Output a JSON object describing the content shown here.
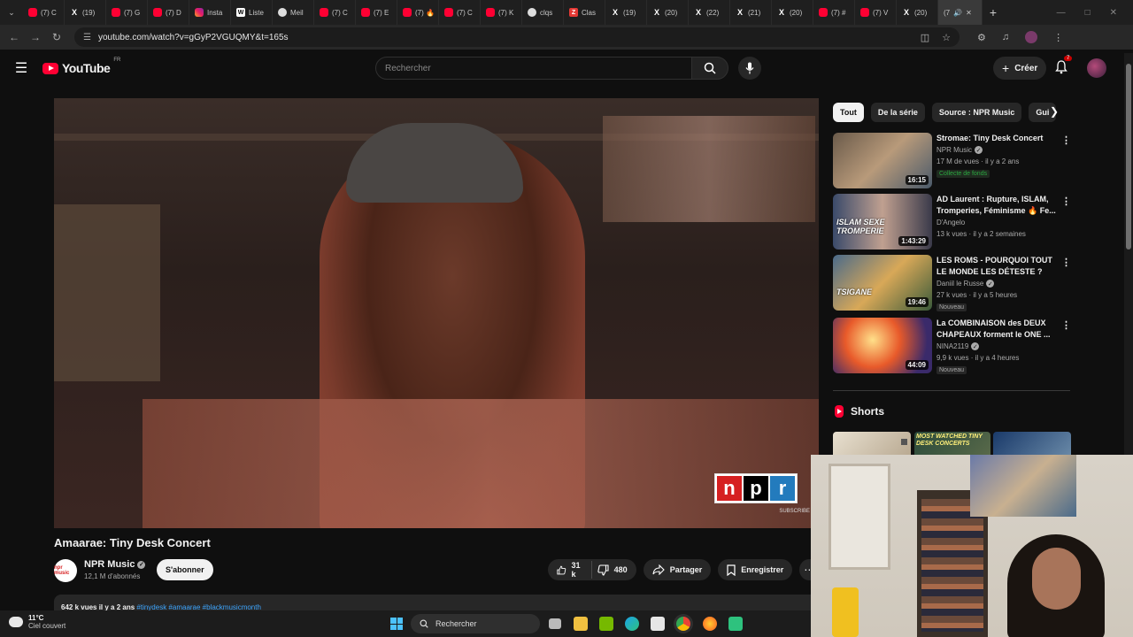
{
  "browser": {
    "tabs": [
      {
        "icon": "yt",
        "label": "(7) C"
      },
      {
        "icon": "x",
        "label": "(19)"
      },
      {
        "icon": "yt",
        "label": "(7) G"
      },
      {
        "icon": "yt",
        "label": "(7) D"
      },
      {
        "icon": "ig",
        "label": "Insta"
      },
      {
        "icon": "w",
        "label": "Liste"
      },
      {
        "icon": "gl",
        "label": "Meil"
      },
      {
        "icon": "yt",
        "label": "(7) C"
      },
      {
        "icon": "yt",
        "label": "(7) E"
      },
      {
        "icon": "yt",
        "label": "(7) 🔥"
      },
      {
        "icon": "yt",
        "label": "(7) C"
      },
      {
        "icon": "yt",
        "label": "(7) K"
      },
      {
        "icon": "gl",
        "label": "clqs"
      },
      {
        "icon": "z",
        "label": "Clas"
      },
      {
        "icon": "x",
        "label": "(19)"
      },
      {
        "icon": "x",
        "label": "(20)"
      },
      {
        "icon": "x",
        "label": "(22)"
      },
      {
        "icon": "x",
        "label": "(21)"
      },
      {
        "icon": "x",
        "label": "(20)"
      },
      {
        "icon": "yt",
        "label": "(7) #"
      },
      {
        "icon": "yt",
        "label": "(7) V"
      },
      {
        "icon": "x",
        "label": "(20)"
      }
    ],
    "active_tab_label": "(7",
    "url": "youtube.com/watch?v=gGyP2VGUQMY&t=165s"
  },
  "header": {
    "logo_text": "YouTube",
    "country": "FR",
    "search_placeholder": "Rechercher",
    "create_label": "Créer",
    "notifications_count": "7"
  },
  "video": {
    "title": "Amaarae: Tiny Desk Concert",
    "channel": "NPR Music",
    "channel_avatar_text": "npr music",
    "subscribers": "12,1 M d'abonnés",
    "subscribe_label": "S'abonner",
    "likes": "31 k",
    "dislikes": "480",
    "share_label": "Partager",
    "save_label": "Enregistrer",
    "description_stats": "642 k vues  il y a 2 ans",
    "description_tags": "#tinydesk #amaarae #blackmusicmonth",
    "npr_letters": [
      "n",
      "p",
      "r"
    ],
    "npr_subscribe": "SUBSCRIBE"
  },
  "sidebar": {
    "chips": [
      "Tout",
      "De la série",
      "Source : NPR Music",
      "Gui"
    ],
    "recommendations": [
      {
        "title": "Stromae: Tiny Desk Concert",
        "channel": "NPR Music",
        "verified": true,
        "meta": "17 M de vues · il y a 2 ans",
        "badge": "Collecte de fonds",
        "badge_type": "fund",
        "duration": "16:15"
      },
      {
        "title": "AD Laurent : Rupture, ISLAM, Tromperies, Féminisme 🔥 Fe...",
        "channel": "D'Angelo",
        "verified": false,
        "meta": "13 k vues · il y a 2 semaines",
        "badge": "",
        "badge_type": "",
        "duration": "1:43:29"
      },
      {
        "title": "LES ROMS - POURQUOI TOUT LE MONDE LES DÉTESTE ?",
        "channel": "Daniil le Russe",
        "verified": true,
        "meta": "27 k vues · il y a 5 heures",
        "badge": "Nouveau",
        "badge_type": "new",
        "duration": "19:46"
      },
      {
        "title": "La COMBINAISON des DEUX CHAPEAUX forment le ONE ...",
        "channel": "NINA2119",
        "verified": true,
        "meta": "9,9 k vues · il y a 4 heures",
        "badge": "Nouveau",
        "badge_type": "new",
        "duration": "44:09"
      }
    ],
    "thumb_texts": [
      "",
      "ISLAM SEXE TROMPERIE",
      "TSIGANE",
      ""
    ],
    "shorts_title": "Shorts",
    "shorts": [
      {
        "label": ""
      },
      {
        "label": "MOST WATCHED TINY DESK CONCERTS"
      },
      {
        "label": ""
      }
    ]
  },
  "taskbar": {
    "temperature": "11°C",
    "weather": "Ciel couvert",
    "search_label": "Rechercher"
  }
}
